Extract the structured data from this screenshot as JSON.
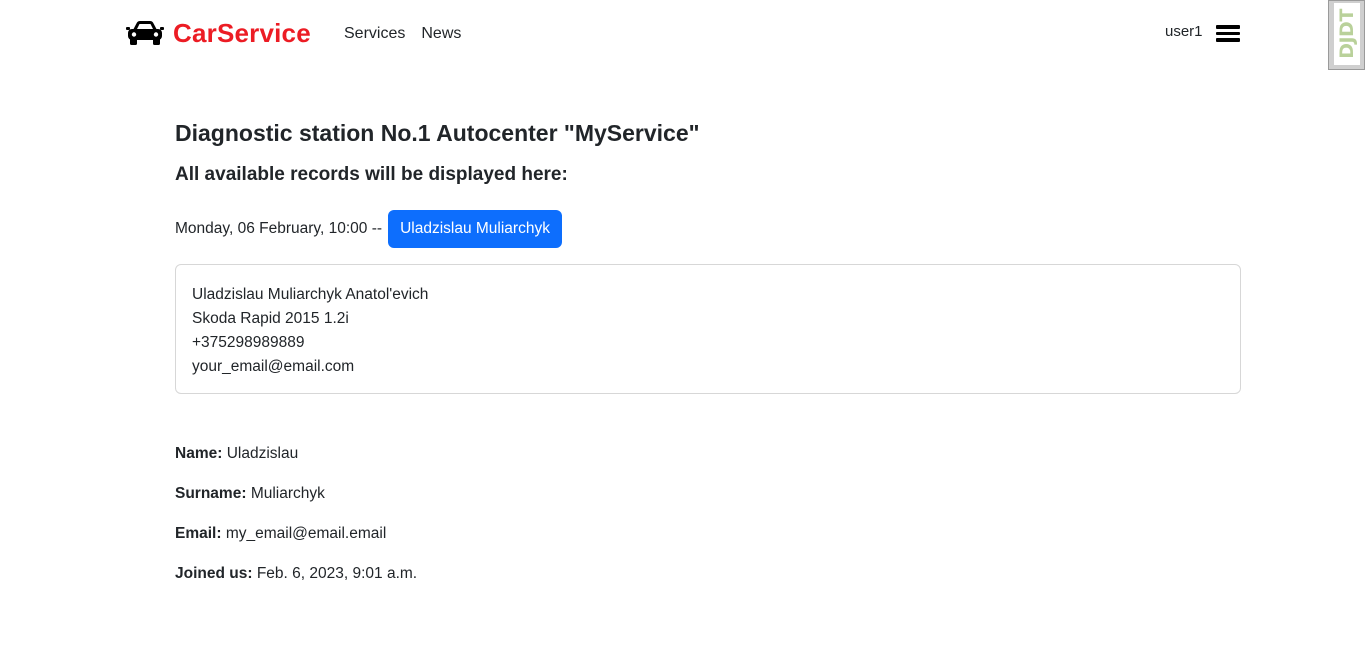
{
  "navbar": {
    "brand": "CarService",
    "links": [
      "Services",
      "News"
    ],
    "user": "user1",
    "icons": {
      "brand": "car-icon",
      "menu": "hamburger-menu-icon"
    },
    "brand_color": "#ec1c24"
  },
  "debug_toolbar": {
    "label": "DJDT"
  },
  "main": {
    "title": "Diagnostic station No.1 Autocenter \"MyService\"",
    "subtitle": "All available records will be displayed here:",
    "record": {
      "datetime": "Monday, 06 February, 10:00 --",
      "button_label": "Uladzislau Muliarchyk",
      "button_color": "#0d6efd"
    },
    "details": [
      "Uladzislau Muliarchyk Anatol'evich",
      "Skoda Rapid 2015 1.2i",
      "+375298989889",
      "your_email@email.com"
    ]
  },
  "profile": {
    "name_label": "Name:",
    "name": "Uladzislau",
    "surname_label": "Surname:",
    "surname": "Muliarchyk",
    "email_label": "Email:",
    "email": "my_email@email.email",
    "joined_label": "Joined us:",
    "joined": "Feb. 6, 2023, 9:01 a.m."
  }
}
